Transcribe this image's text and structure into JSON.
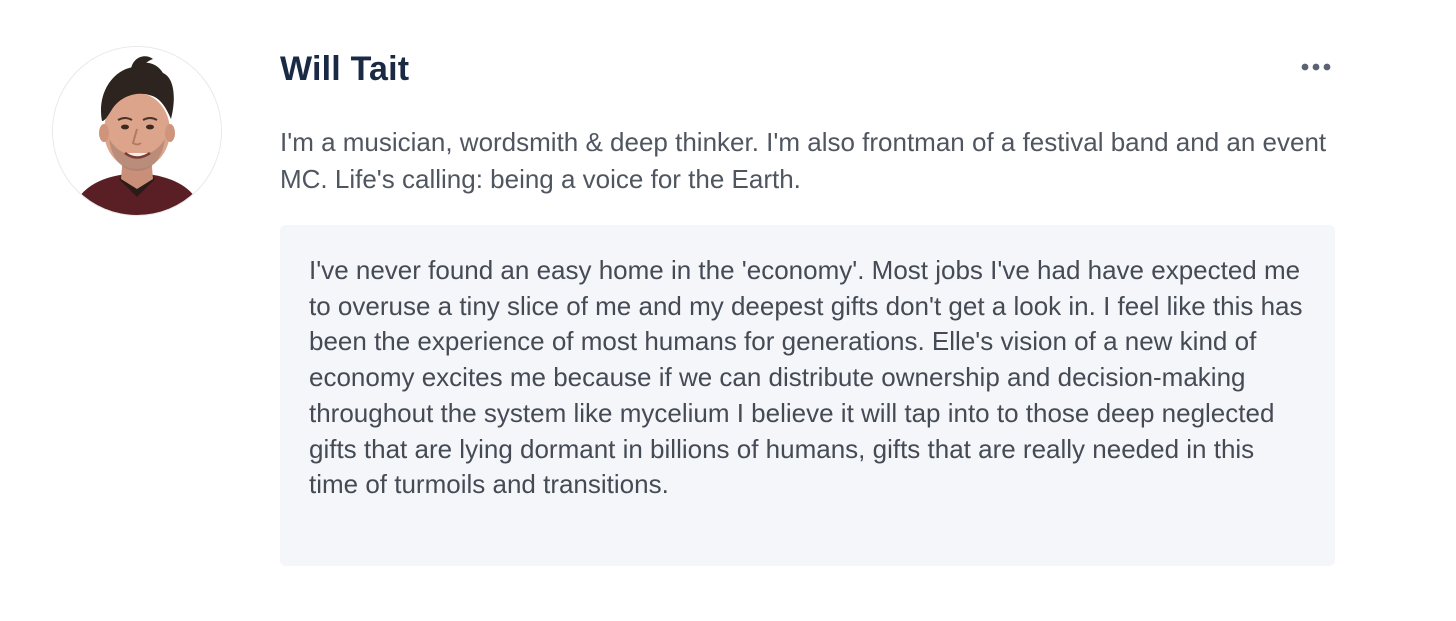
{
  "profile": {
    "name": "Will Tait",
    "bio": "I'm a musician, wordsmith & deep thinker. I'm also frontman of a festival band and an event MC. Life's calling: being a voice for the Earth.",
    "quote": "I've never found an easy home in the 'economy'. Most jobs I've had have expected me to overuse a tiny slice of me and my deepest gifts don't get a look in. I feel like this has been the experience of most humans for generations. Elle's vision of a new kind of economy excites me because if we can distribute ownership and decision-making throughout the system like mycelium I believe it will tap into to those deep neglected gifts that are lying dormant in billions of humans, gifts that are really needed in this time of turmoils and transitions.",
    "avatar_icon": "person-portrait",
    "more_icon": "more-horizontal-icon"
  },
  "colors": {
    "name": "#1b2a44",
    "body_text": "#505660",
    "quote_background": "#f5f6fa",
    "more_dots": "#5b6372"
  }
}
